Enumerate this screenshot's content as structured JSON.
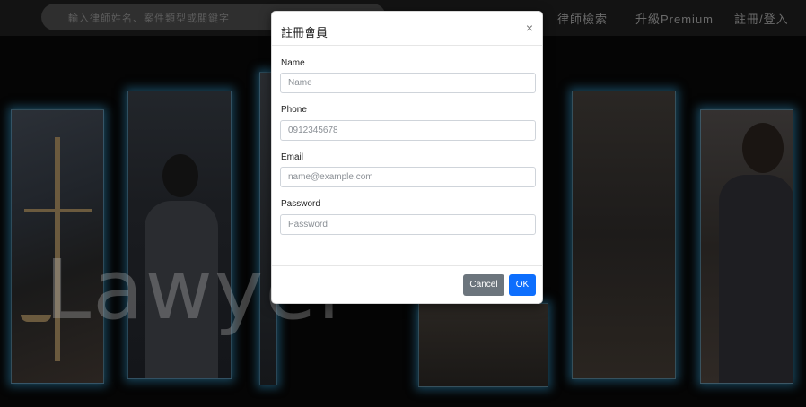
{
  "nav": {
    "search_placeholder": "輸入律師姓名、案件類型或關鍵字",
    "links": [
      "律師檢索",
      "升級Premium",
      "註冊/登入"
    ]
  },
  "background": {
    "watermark_text": "Lawyer"
  },
  "modal": {
    "title": "註冊會員",
    "close_symbol": "×",
    "fields": [
      {
        "label": "Name",
        "placeholder": "Name",
        "value": ""
      },
      {
        "label": "Phone",
        "placeholder": "0912345678",
        "value": ""
      },
      {
        "label": "Email",
        "placeholder": "name@example.com",
        "value": ""
      },
      {
        "label": "Password",
        "placeholder": "Password",
        "value": ""
      }
    ],
    "cancel_label": "Cancel",
    "ok_label": "OK"
  },
  "colors": {
    "primary": "#0d6efd",
    "secondary": "#6c757d",
    "panel_glow": "#2878a0"
  }
}
